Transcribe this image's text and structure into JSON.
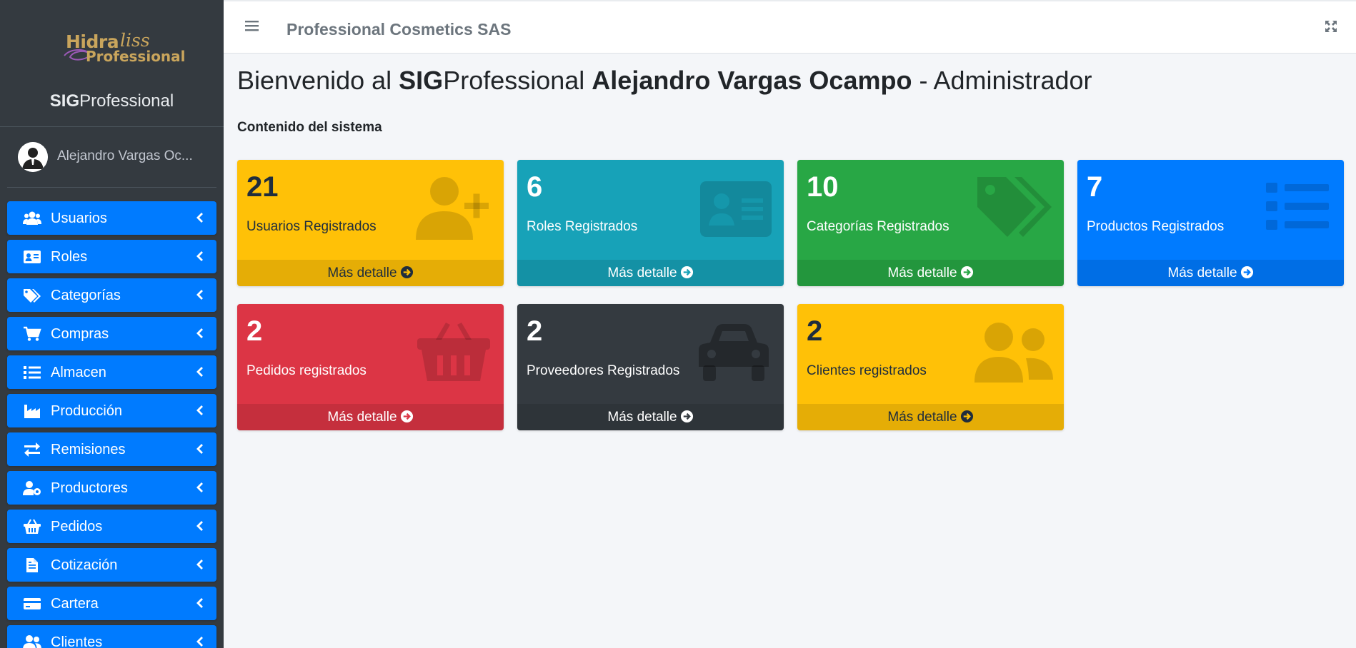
{
  "brand": {
    "logo_line1": "Hidra",
    "logo_line1_script": "liss",
    "logo_line2": "Professional",
    "name_bold": "SIG",
    "name_light": "Professional"
  },
  "user": {
    "name": "Alejandro Vargas Oc..."
  },
  "sidebar": {
    "items": [
      {
        "label": "Usuarios",
        "icon": "users-icon"
      },
      {
        "label": "Roles",
        "icon": "id-card-icon"
      },
      {
        "label": "Categorías",
        "icon": "tags-icon"
      },
      {
        "label": "Compras",
        "icon": "cart-icon"
      },
      {
        "label": "Almacen",
        "icon": "list-icon"
      },
      {
        "label": "Producción",
        "icon": "industry-icon"
      },
      {
        "label": "Remisiones",
        "icon": "exchange-icon"
      },
      {
        "label": "Productores",
        "icon": "user-cog-icon"
      },
      {
        "label": "Pedidos",
        "icon": "basket-icon"
      },
      {
        "label": "Cotización",
        "icon": "file-icon"
      },
      {
        "label": "Cartera",
        "icon": "credit-card-icon"
      },
      {
        "label": "Clientes",
        "icon": "user-friends-icon"
      }
    ]
  },
  "topbar": {
    "company": "Professional Cosmetics SAS"
  },
  "main": {
    "title_pre": "Bienvenido al ",
    "title_sig": "SIG",
    "title_prof": "Professional ",
    "title_user": "Alejandro Vargas Ocampo",
    "title_role": " - Administrador",
    "section": "Contenido del sistema"
  },
  "boxes": [
    {
      "count": "21",
      "label": "Usuarios Registrados",
      "link": "Más detalle",
      "color": "#ffc107",
      "icon": "user-plus-icon"
    },
    {
      "count": "6",
      "label": "Roles Registrados",
      "link": "Más detalle",
      "color": "#17a2b8",
      "icon": "id-card-icon"
    },
    {
      "count": "10",
      "label": "Categorías Registrados",
      "link": "Más detalle",
      "color": "#28a745",
      "icon": "tags-icon"
    },
    {
      "count": "7",
      "label": "Productos Registrados",
      "link": "Más detalle",
      "color": "#007bff",
      "icon": "list-icon"
    },
    {
      "count": "2",
      "label": "Pedidos registrados",
      "link": "Más detalle",
      "color": "#dc3545",
      "icon": "basket-icon"
    },
    {
      "count": "2",
      "label": "Proveedores Registrados",
      "link": "Más detalle",
      "color": "#343a40",
      "icon": "car-icon"
    },
    {
      "count": "2",
      "label": "Clientes registrados",
      "link": "Más detalle",
      "color": "#ffc107",
      "icon": "user-friends-icon"
    }
  ]
}
